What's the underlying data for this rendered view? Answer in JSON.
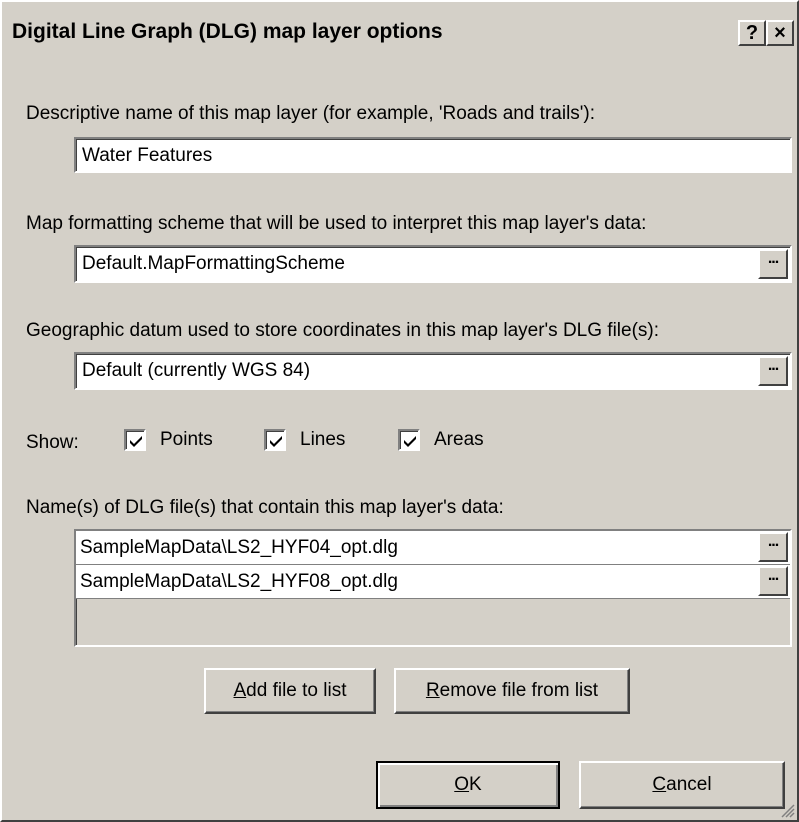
{
  "dialog": {
    "title": "Digital Line Graph (DLG) map layer options",
    "help_glyph": "?",
    "close_glyph": "×"
  },
  "name_section": {
    "label": "Descriptive name of this map layer (for example, 'Roads and trails'):",
    "value": "Water Features"
  },
  "scheme_section": {
    "label": "Map formatting scheme that will be used to interpret this map layer's data:",
    "value": "Default.MapFormattingScheme",
    "browse_label": "..."
  },
  "datum_section": {
    "label": "Geographic datum used to store coordinates in this map layer's DLG file(s):",
    "value": "Default (currently WGS 84)",
    "browse_label": "..."
  },
  "show": {
    "label": "Show:",
    "options": [
      {
        "label": "Points",
        "checked": true
      },
      {
        "label": "Lines",
        "checked": true
      },
      {
        "label": "Areas",
        "checked": true
      }
    ]
  },
  "files_section": {
    "label": "Name(s) of DLG file(s) that contain this map layer's data:",
    "files": [
      {
        "path": "SampleMapData\\LS2_HYF04_opt.dlg",
        "browse_label": "..."
      },
      {
        "path": "SampleMapData\\LS2_HYF08_opt.dlg",
        "browse_label": "..."
      }
    ]
  },
  "buttons": {
    "add_accel": "A",
    "add_rest": "dd file to list",
    "remove_accel": "R",
    "remove_rest": "emove file from list",
    "ok_accel": "O",
    "ok_rest": "K",
    "cancel_accel": "C",
    "cancel_rest": "ancel"
  }
}
